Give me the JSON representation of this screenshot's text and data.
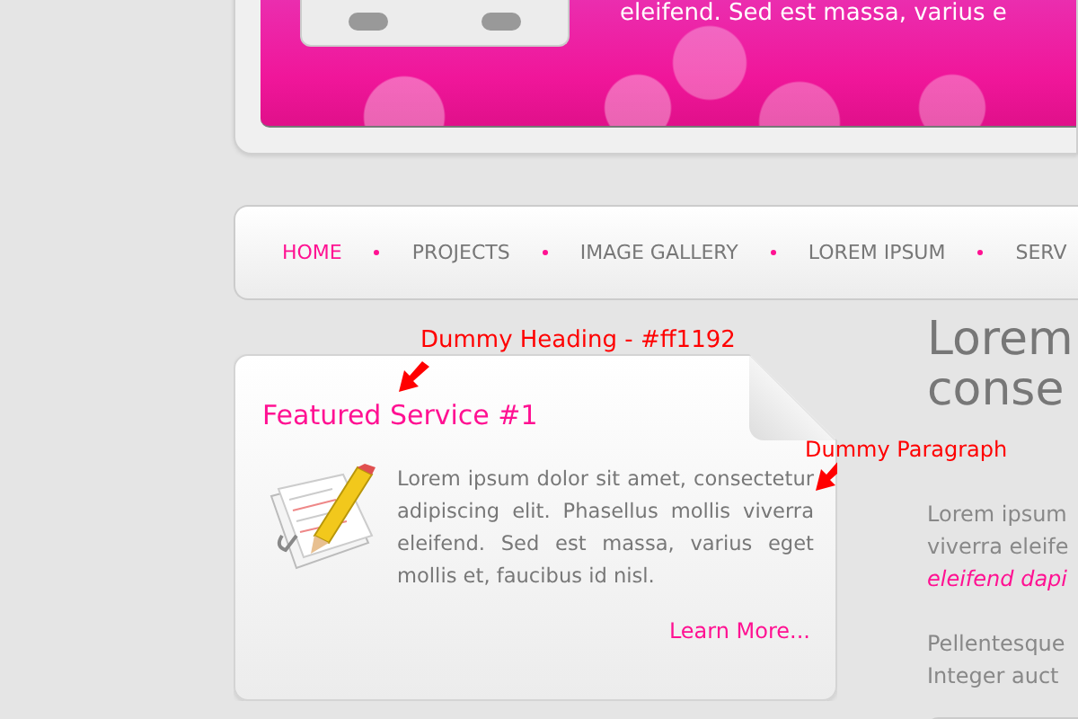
{
  "banner": {
    "text": "eleifend. Sed est massa, varius e"
  },
  "nav": {
    "items": [
      {
        "label": "HOME",
        "selected": true
      },
      {
        "label": "PROJECTS",
        "selected": false
      },
      {
        "label": "IMAGE GALLERY",
        "selected": false
      },
      {
        "label": "LOREM IPSUM",
        "selected": false
      },
      {
        "label": "SERV",
        "selected": false
      }
    ]
  },
  "annotations": [
    {
      "text": "Dummy Heading - #ff1192"
    },
    {
      "text": "Dummy Paragraph"
    }
  ],
  "service": {
    "title": "Featured Service #1",
    "paragraph": "Lorem ipsum dolor sit amet, consectetur adipiscing elit. Phasellus mollis viverra eleifend. Sed est massa, varius eget mollis et, faucibus id nisl.",
    "link": "Learn More..."
  },
  "main": {
    "heading_lines": [
      "Lorem",
      "conse"
    ],
    "lines": [
      {
        "text": "Lorem ipsum",
        "kind": "plain"
      },
      {
        "text": "viverra eleife",
        "kind": "plain"
      },
      {
        "text": "eleifend dapi",
        "kind": "emphasis"
      },
      {
        "text": "Pellentesque",
        "kind": "gap"
      },
      {
        "text": "Integer auct",
        "kind": "plain"
      }
    ]
  }
}
